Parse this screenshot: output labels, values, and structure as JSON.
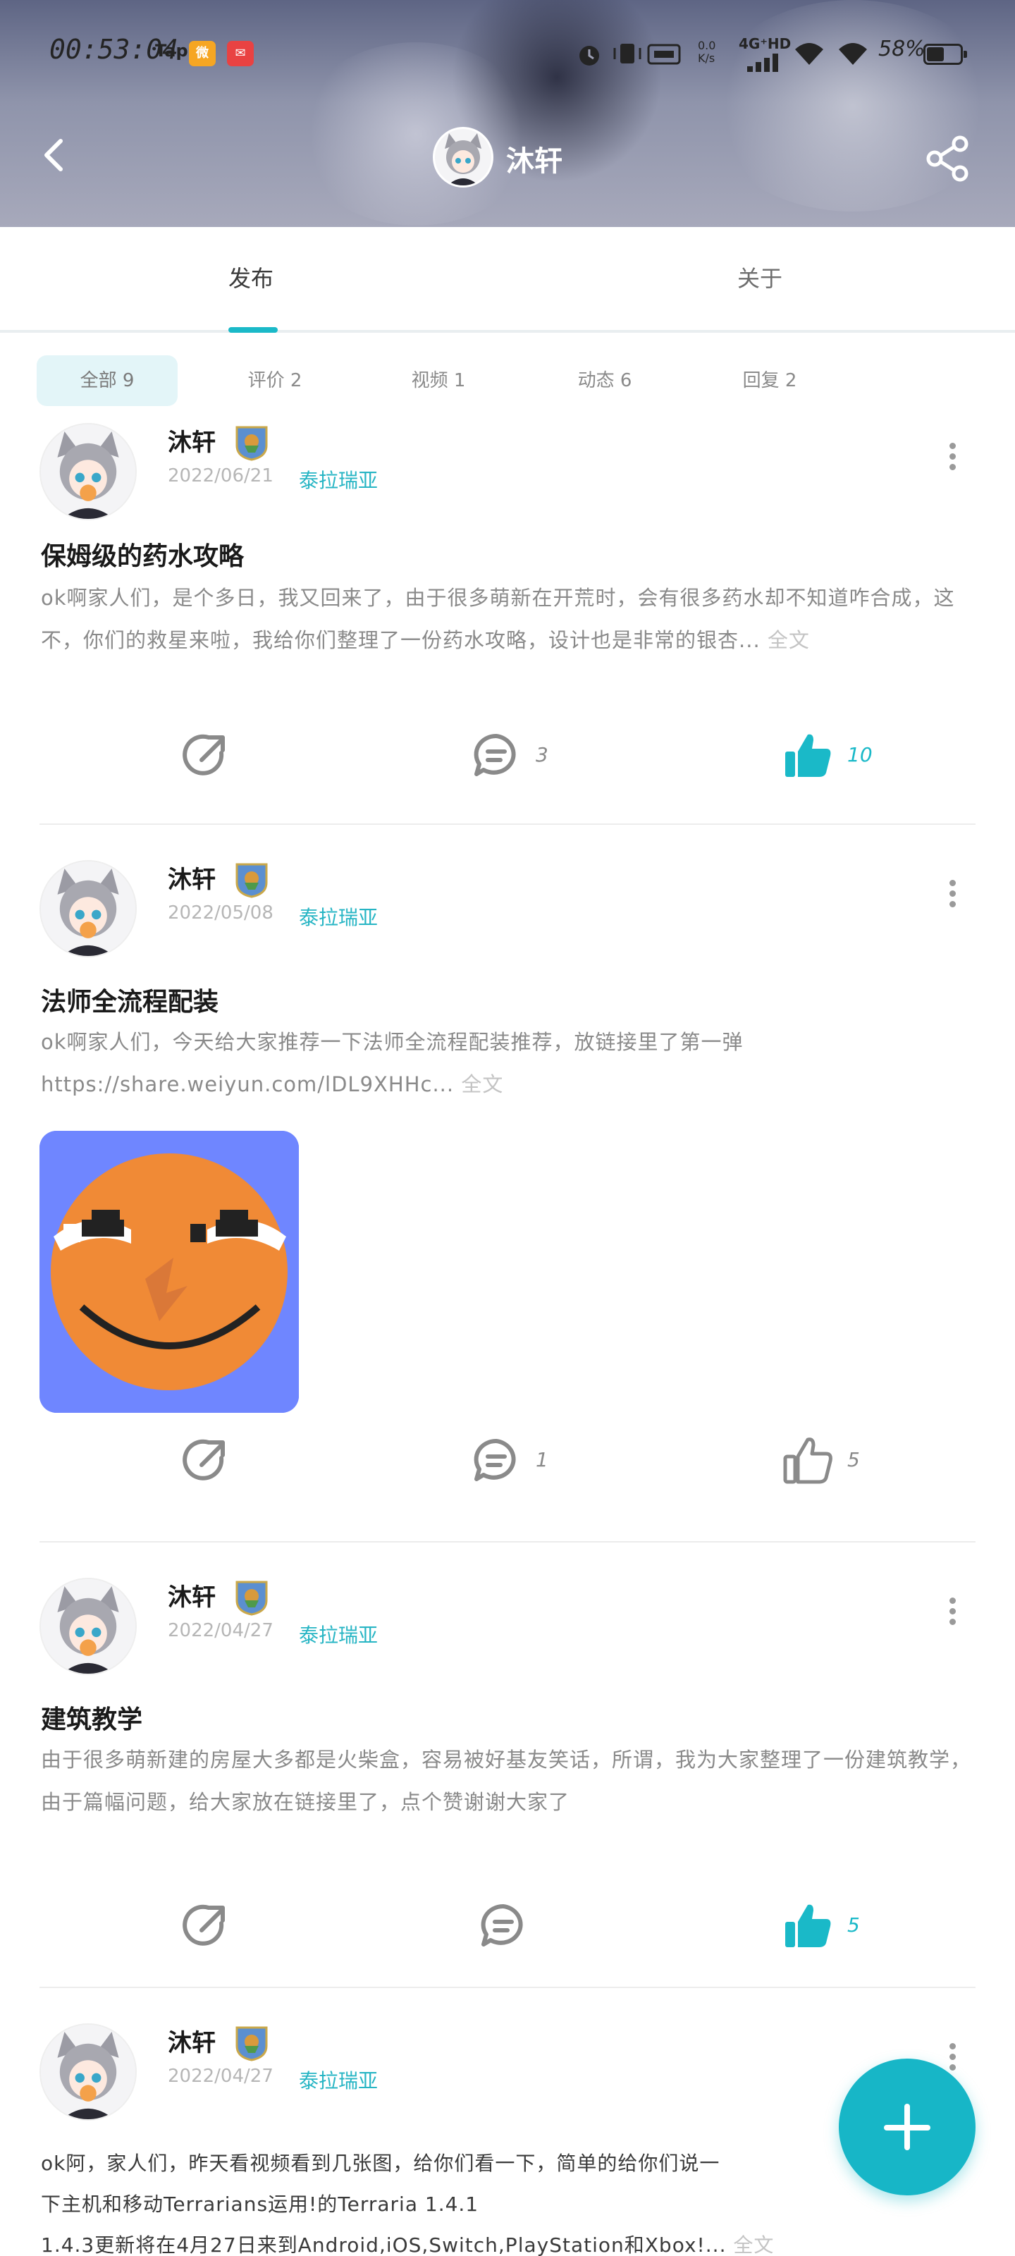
{
  "status_bar": {
    "time": "00:53:04",
    "app_label": "Tap",
    "network": "4G⁺HD",
    "battery": "58%"
  },
  "header": {
    "profile_name": "沐轩"
  },
  "tabs": [
    {
      "label": "发布",
      "active": true
    },
    {
      "label": "关于",
      "active": false
    }
  ],
  "filters": [
    {
      "label": "全部 9",
      "active": true
    },
    {
      "label": "评价 2",
      "active": false
    },
    {
      "label": "视频 1",
      "active": false
    },
    {
      "label": "动态 6",
      "active": false
    },
    {
      "label": "回复 2",
      "active": false
    }
  ],
  "colors": {
    "accent": "#1ab9c8",
    "region": "#27b5c4"
  },
  "posts": [
    {
      "author": "沐轩",
      "date": "2022/06/21",
      "region": "泰拉瑞亚",
      "title": "保姆级的药水攻略",
      "body": "ok啊家人们，是个多日，我又回来了，由于很多萌新在开荒时，会有很多药水却不知道咋合成，这不，你们的救星来啦，我给你们整理了一份药水攻略，设计也是非常的银杏...",
      "more": "全文",
      "shares": "",
      "comments": "3",
      "likes": "10",
      "liked": true
    },
    {
      "author": "沐轩",
      "date": "2022/05/08",
      "region": "泰拉瑞亚",
      "title": "法师全流程配装",
      "body": "ok啊家人们，今天给大家推荐一下法师全流程配装推荐，放链接里了第一弹https://share.weiyun.com/lDL9XHHc...",
      "more": "全文",
      "shares": "",
      "comments": "1",
      "likes": "5",
      "liked": false
    },
    {
      "author": "沐轩",
      "date": "2022/04/27",
      "region": "泰拉瑞亚",
      "title": "建筑教学",
      "body": "由于很多萌新建的房屋大多都是火柴盒，容易被好基友笑话，所谓，我为大家整理了一份建筑教学，由于篇幅问题，给大家放在链接里了，点个赞谢谢大家了",
      "more": "",
      "shares": "",
      "comments": "",
      "likes": "5",
      "liked": true
    },
    {
      "author": "沐轩",
      "date": "2022/04/27",
      "region": "泰拉瑞亚",
      "title": "",
      "body_lines": [
        "ok阿，家人们，昨天看视频看到几张图，给你们看一下，简单的给你们说一",
        "下主机和移动Terrarians运用!的Terraria 1.4.1",
        "1.4.3更新将在4月27日来到Android,iOS,Switch,PlayStation和Xbox!..."
      ],
      "more": "全文"
    }
  ]
}
